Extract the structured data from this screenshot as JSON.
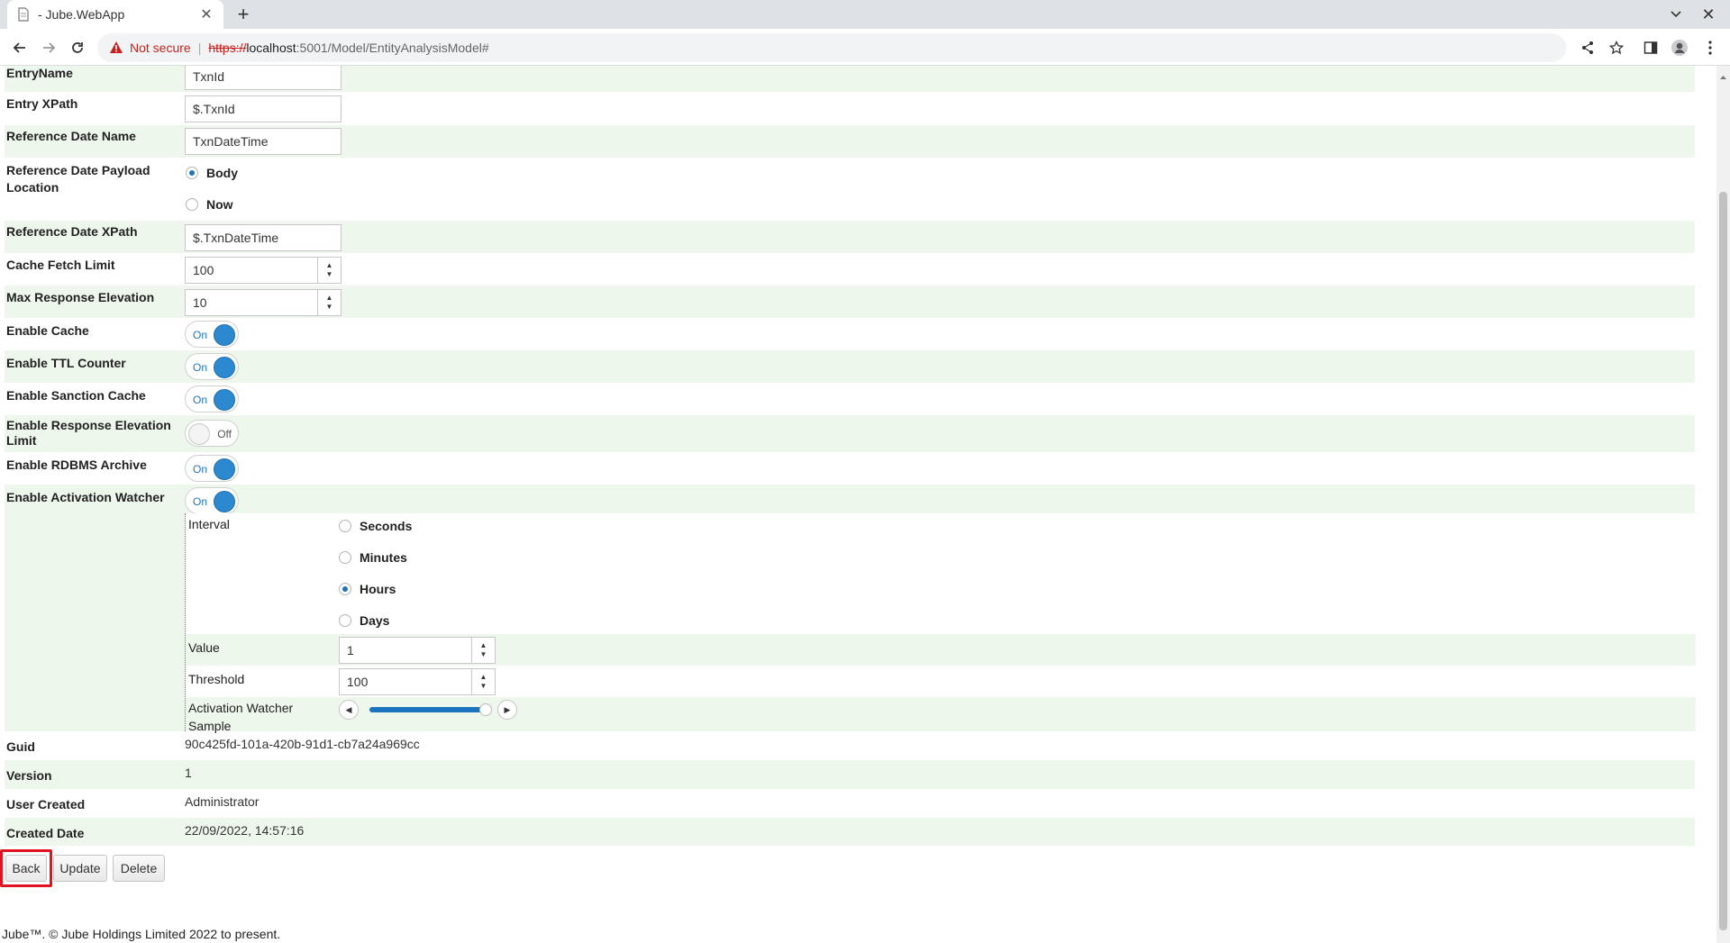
{
  "browser": {
    "tab_title": "- Jube.WebApp",
    "not_secure": "Not secure",
    "url_scheme": "https://",
    "url_host": "localhost",
    "url_rest": ":5001/Model/EntityAnalysisModel#"
  },
  "form": {
    "entry_name": {
      "label": "EntryName",
      "value": "TxnId"
    },
    "entry_xpath": {
      "label": "Entry XPath",
      "value": "$.TxnId"
    },
    "ref_date_name": {
      "label": "Reference Date Name",
      "value": "TxnDateTime"
    },
    "ref_date_payload": {
      "label": "Reference Date Payload Location",
      "options": [
        "Body",
        "Now"
      ],
      "selected": "Body"
    },
    "ref_date_xpath": {
      "label": "Reference Date XPath",
      "value": "$.TxnDateTime"
    },
    "cache_fetch_limit": {
      "label": "Cache Fetch Limit",
      "value": "100"
    },
    "max_response_elevation": {
      "label": "Max Response Elevation",
      "value": "10"
    },
    "enable_cache": {
      "label": "Enable Cache",
      "state": "On"
    },
    "enable_ttl": {
      "label": "Enable TTL Counter",
      "state": "On"
    },
    "enable_sanction": {
      "label": "Enable Sanction Cache",
      "state": "On"
    },
    "enable_resp_elev_limit": {
      "label": "Enable Response Elevation Limit",
      "state": "Off"
    },
    "enable_rdbms": {
      "label": "Enable RDBMS Archive",
      "state": "On"
    },
    "enable_activation_watcher": {
      "label": "Enable Activation Watcher",
      "state": "On"
    },
    "watcher": {
      "interval_label": "Interval",
      "interval_options": [
        "Seconds",
        "Minutes",
        "Hours",
        "Days"
      ],
      "interval_selected": "Hours",
      "value_label": "Value",
      "value": "1",
      "threshold_label": "Threshold",
      "threshold": "100",
      "sample_label": "Activation Watcher Sample",
      "sample_level": 1.0
    },
    "guid": {
      "label": "Guid",
      "value": "90c425fd-101a-420b-91d1-cb7a24a969cc"
    },
    "version": {
      "label": "Version",
      "value": "1"
    },
    "user_created": {
      "label": "User Created",
      "value": "Administrator"
    },
    "created_date": {
      "label": "Created Date",
      "value": "22/09/2022, 14:57:16"
    }
  },
  "buttons": {
    "back": "Back",
    "update": "Update",
    "delete": "Delete"
  },
  "footer": "Jube™. © Jube Holdings Limited 2022 to present.",
  "colors": {
    "accent": "#1e73be",
    "row_alt": "#eef7ec",
    "highlight": "#e0141e"
  }
}
